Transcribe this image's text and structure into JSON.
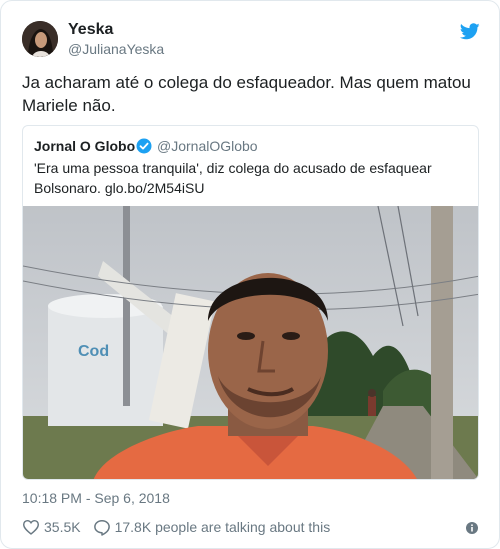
{
  "author": {
    "name": "Yeska",
    "handle": "@JulianaYeska"
  },
  "tweet": {
    "text": "Ja acharam até o colega do esfaqueador. Mas quem matou Mariele não."
  },
  "quoted_tweet": {
    "name": "Jornal O Globo",
    "handle": "@JornalOGlobo",
    "text": "'Era uma pessoa tranquila', diz colega do acusado de esfaquear Bolsonaro. glo.bo/2M54iSU",
    "image_sign_text": "Cod"
  },
  "meta": {
    "timestamp": "10:18 PM - Sep 6, 2018"
  },
  "actions": {
    "likes": "35.5K",
    "talking": "17.8K people are talking about this"
  },
  "icons": {
    "twitter": "twitter-bird-icon",
    "verified": "verified-badge-icon",
    "like": "heart-icon",
    "reply": "speech-bubble-icon",
    "info": "info-icon"
  },
  "colors": {
    "twitter_blue": "#1da1f2",
    "text_primary": "#1c2022",
    "text_secondary": "#697882",
    "border": "#e1e8ed"
  }
}
